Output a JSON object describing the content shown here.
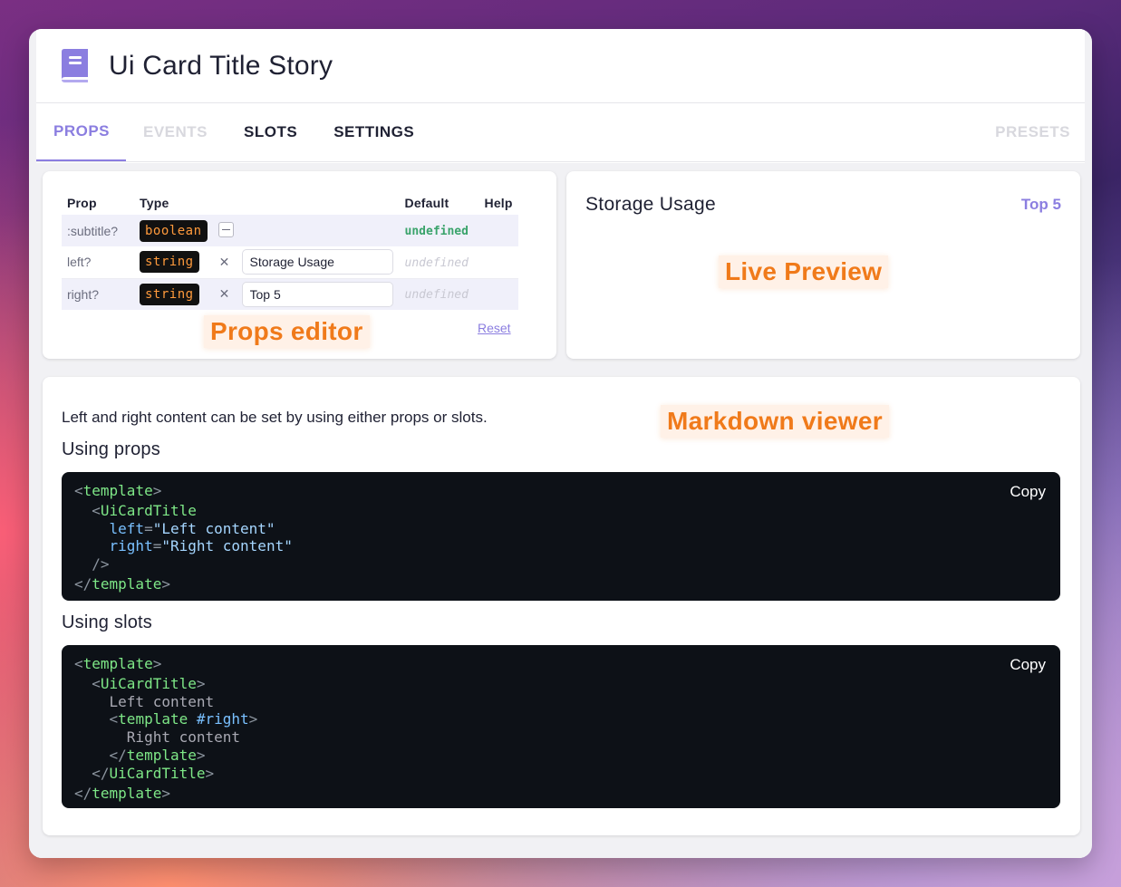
{
  "header": {
    "title": "Ui Card Title Story",
    "icon": "book-icon"
  },
  "tabs": [
    {
      "label": "PROPS",
      "state": "active"
    },
    {
      "label": "EVENTS",
      "state": "disabled"
    },
    {
      "label": "SLOTS",
      "state": "normal"
    },
    {
      "label": "SETTINGS",
      "state": "normal"
    },
    {
      "label": "PRESETS",
      "state": "disabled"
    }
  ],
  "props_editor": {
    "headers": {
      "prop": "Prop",
      "type": "Type",
      "default": "Default",
      "help": "Help"
    },
    "rows": [
      {
        "name": ":subtitle?",
        "type": "boolean",
        "value": "",
        "default": "undefined"
      },
      {
        "name": "left?",
        "type": "string",
        "value": "Storage Usage",
        "default": "undefined"
      },
      {
        "name": "right?",
        "type": "string",
        "value": "Top 5",
        "default": "undefined"
      }
    ],
    "clear_symbol": "✕",
    "reset_label": "Reset",
    "callout": "Props editor"
  },
  "preview": {
    "title": "Storage Usage",
    "right": "Top 5",
    "callout": "Live Preview"
  },
  "markdown": {
    "callout": "Markdown viewer",
    "intro": "Left and right content can be set by using either props or slots.",
    "heading_props": "Using props",
    "heading_slots": "Using slots",
    "copy_label": "Copy"
  },
  "colors": {
    "accent": "#8b7ee0",
    "callout": "#f07a1a",
    "code_bg": "#0d1117",
    "type_badge": "#ff9a3c"
  }
}
